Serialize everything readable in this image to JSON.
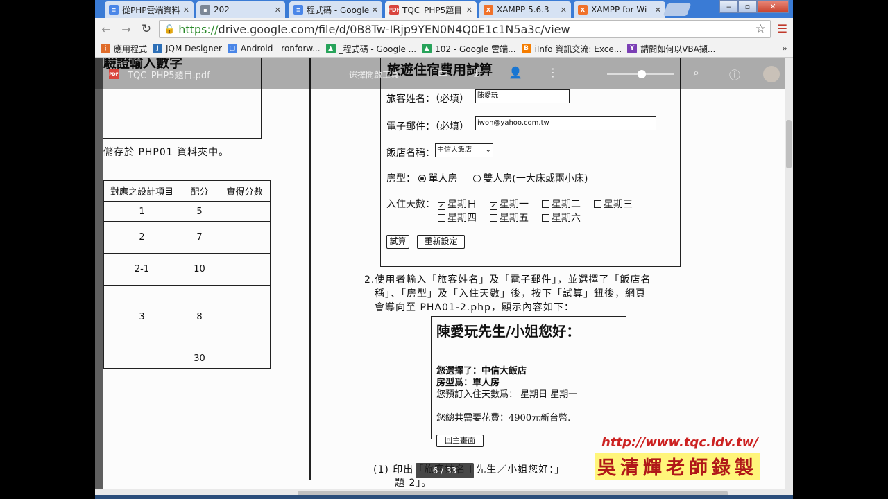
{
  "tabs": [
    {
      "label": "從PHP雲端資料",
      "icon": "doc-icon",
      "color": "#4a86e8"
    },
    {
      "label": "202",
      "icon": "folder-icon",
      "color": "#7b8796"
    },
    {
      "label": "程式碼 - Google",
      "icon": "doc-icon",
      "color": "#4a86e8"
    },
    {
      "label": "TQC_PHP5題目",
      "icon": "pdf-icon",
      "color": "#d9453d"
    },
    {
      "label": "XAMPP 5.6.3",
      "icon": "xampp-icon",
      "color": "#f0712a"
    },
    {
      "label": "XAMPP for Wi",
      "icon": "xampp-icon",
      "color": "#f0712a"
    }
  ],
  "window": {
    "minimize": "‒",
    "maximize": "▫",
    "close": "✕"
  },
  "address": {
    "https": "https://",
    "rest": "drive.google.com/file/d/0B8Tw-IRjp9YEN0N4Q0E1c1N5a3c/view"
  },
  "bookmarks": [
    {
      "label": "應用程式",
      "icon": "apps-icon",
      "color": "#e06c2a"
    },
    {
      "label": "JQM Designer",
      "icon": "jqm-icon",
      "color": "#2d6fb7"
    },
    {
      "label": "Android - ronforw...",
      "icon": "page-icon",
      "color": "#4a86e8"
    },
    {
      "label": "_程式碼 - Google ...",
      "icon": "drive-icon",
      "color": "#27a35a"
    },
    {
      "label": "102 - Google 雲端...",
      "icon": "drive-icon",
      "color": "#27a35a"
    },
    {
      "label": "iInfo 資訊交流: Exce...",
      "icon": "blogger-icon",
      "color": "#f57d00"
    },
    {
      "label": "請問如何以VBA擷...",
      "icon": "yahoo-icon",
      "color": "#7b3fb5"
    }
  ],
  "viewer": {
    "title": "TQC_PHP5題目.pdf",
    "open_with": "選擇開啟工具",
    "page_indicator": "6 / 33"
  },
  "left_page": {
    "top_heading": "驗證輸入數字",
    "storage_note": "儲存於 PHP01 資料夾中。",
    "table_headers": [
      "對應之設計項目",
      "配分",
      "實得分數"
    ],
    "table_rows": [
      {
        "item": "1",
        "score": "5"
      },
      {
        "item": "2",
        "score": "7"
      },
      {
        "item": "2-1",
        "score": "10"
      },
      {
        "item": "3",
        "score": "8"
      },
      {
        "item": "",
        "score": "30"
      }
    ]
  },
  "form": {
    "title": "旅遊住宿費用試算",
    "name_label": "旅客姓名：（必填）",
    "name_value": "陳愛玩",
    "email_label": "電子郵件：（必填）",
    "email_value": "iwon@yahoo.com.tw",
    "hotel_label": "飯店名稱：",
    "hotel_value": "中信大飯店",
    "room_label": "房型：",
    "room_single": "單人房",
    "room_double": "雙人房(一大床或兩小床)",
    "days_label": "入住天數：",
    "days": [
      "星期日",
      "星期一",
      "星期二",
      "星期三",
      "星期四",
      "星期五",
      "星期六"
    ],
    "calc_button": "試算",
    "reset_button": "重新設定"
  },
  "instruction": {
    "line1": "2.使用者輸入「旅客姓名」及「電子郵件」，並選擇了「飯店名",
    "line2": "稱」、「房型」及「入住天數」後，按下「試算」鈕後，網頁",
    "line3": "會導向至 PHA01-2.php，顯示內容如下："
  },
  "result": {
    "greeting": "陳愛玩先生/小姐您好：",
    "chosen": "您選擇了：中信大飯店",
    "room": "房型爲：單人房",
    "days": "您預訂入住天數爲： 星期日 星期一",
    "total": "您總共需要花費：4900元新台幣.",
    "home_button": "回主畫面"
  },
  "footnote": {
    "line1": "(1)  印出「旅客姓名＋先生／小姐您好：」",
    "line2": "題 2」。"
  },
  "watermark": {
    "url": "http://www.tqc.idv.tw/",
    "name": "吳清輝老師錄製"
  }
}
